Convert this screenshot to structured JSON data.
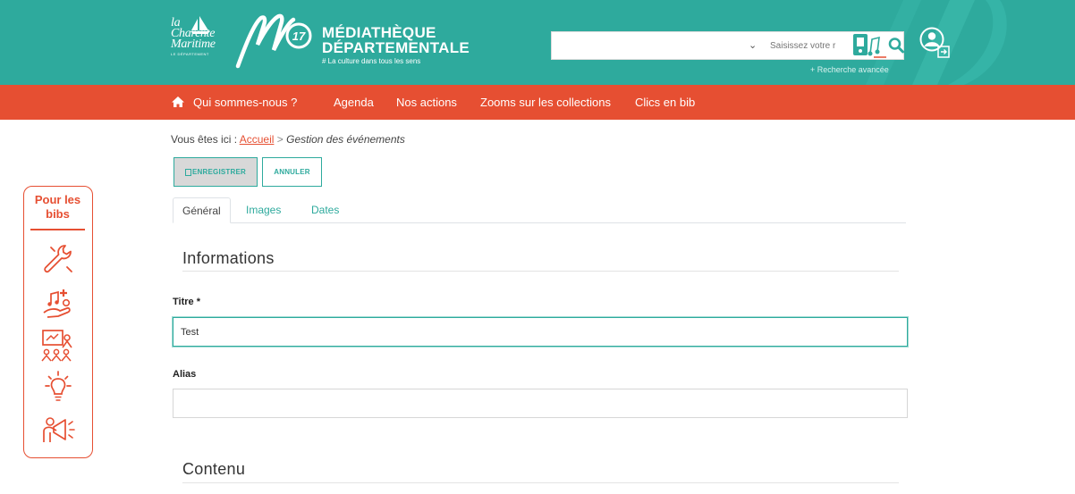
{
  "header": {
    "partner_logo_lines": [
      "la",
      "Charente",
      "Maritime"
    ],
    "partner_logo_sub": "LE DÉPARTEMENT",
    "logo_badge": "17",
    "brand_line1": "MÉDIATHÈQUE",
    "brand_line2": "DÉPARTEMENTALE",
    "brand_tagline": "# La culture dans tous les sens",
    "search": {
      "placeholder": "Saisissez votre r",
      "selected_option": ""
    },
    "advanced_search": "+ Recherche avancée",
    "colors": {
      "primary": "#2eaa9d",
      "accent": "#e64f32"
    }
  },
  "nav": {
    "home_icon": "home-icon",
    "items": [
      "Qui sommes-nous ?",
      "Agenda",
      "Nos actions",
      "Zooms sur les collections",
      "Clics en bib"
    ]
  },
  "side_widget": {
    "title_line1": "Pour les",
    "title_line2": "bibs",
    "icons": [
      "wrench-icon",
      "hand-music-icon",
      "training-icon",
      "lightbulb-icon",
      "megaphone-icon"
    ]
  },
  "breadcrumb": {
    "prefix": "Vous êtes ici :",
    "home": "Accueil",
    "separator": ">",
    "current": "Gestion des événements"
  },
  "toolbar": {
    "save_label": "ENREGISTRER",
    "cancel_label": "ANNULER"
  },
  "tabs": [
    "Général",
    "Images",
    "Dates"
  ],
  "form": {
    "section_informations": "Informations",
    "title_label": "Titre *",
    "title_value": "Test",
    "alias_label": "Alias",
    "alias_value": "",
    "section_contenu": "Contenu"
  }
}
